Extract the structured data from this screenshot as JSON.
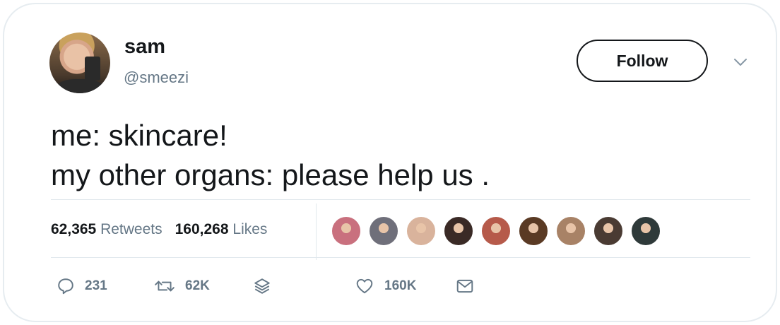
{
  "tweet": {
    "author": {
      "name": "sam",
      "handle": "@smeezi"
    },
    "follow_label": "Follow",
    "text_lines": [
      "me: skincare!",
      "my other organs: please help us ."
    ],
    "stats": {
      "retweets_count": "62,365",
      "retweets_label": "Retweets",
      "likes_count": "160,268",
      "likes_label": "Likes"
    },
    "likers": [
      {
        "icon": "avatar-1",
        "color": "#c9707e"
      },
      {
        "icon": "avatar-2",
        "color": "#6f6f7a"
      },
      {
        "icon": "avatar-3",
        "color": "#d9b39c"
      },
      {
        "icon": "avatar-4",
        "color": "#3a2a26"
      },
      {
        "icon": "avatar-5",
        "color": "#b65a4a"
      },
      {
        "icon": "avatar-6",
        "color": "#5a3a24"
      },
      {
        "icon": "avatar-7",
        "color": "#a88266"
      },
      {
        "icon": "avatar-8",
        "color": "#4a3b33"
      },
      {
        "icon": "avatar-9",
        "color": "#2f3a3a"
      }
    ],
    "actions": {
      "replies": "231",
      "retweets": "62K",
      "likes": "160K"
    }
  }
}
